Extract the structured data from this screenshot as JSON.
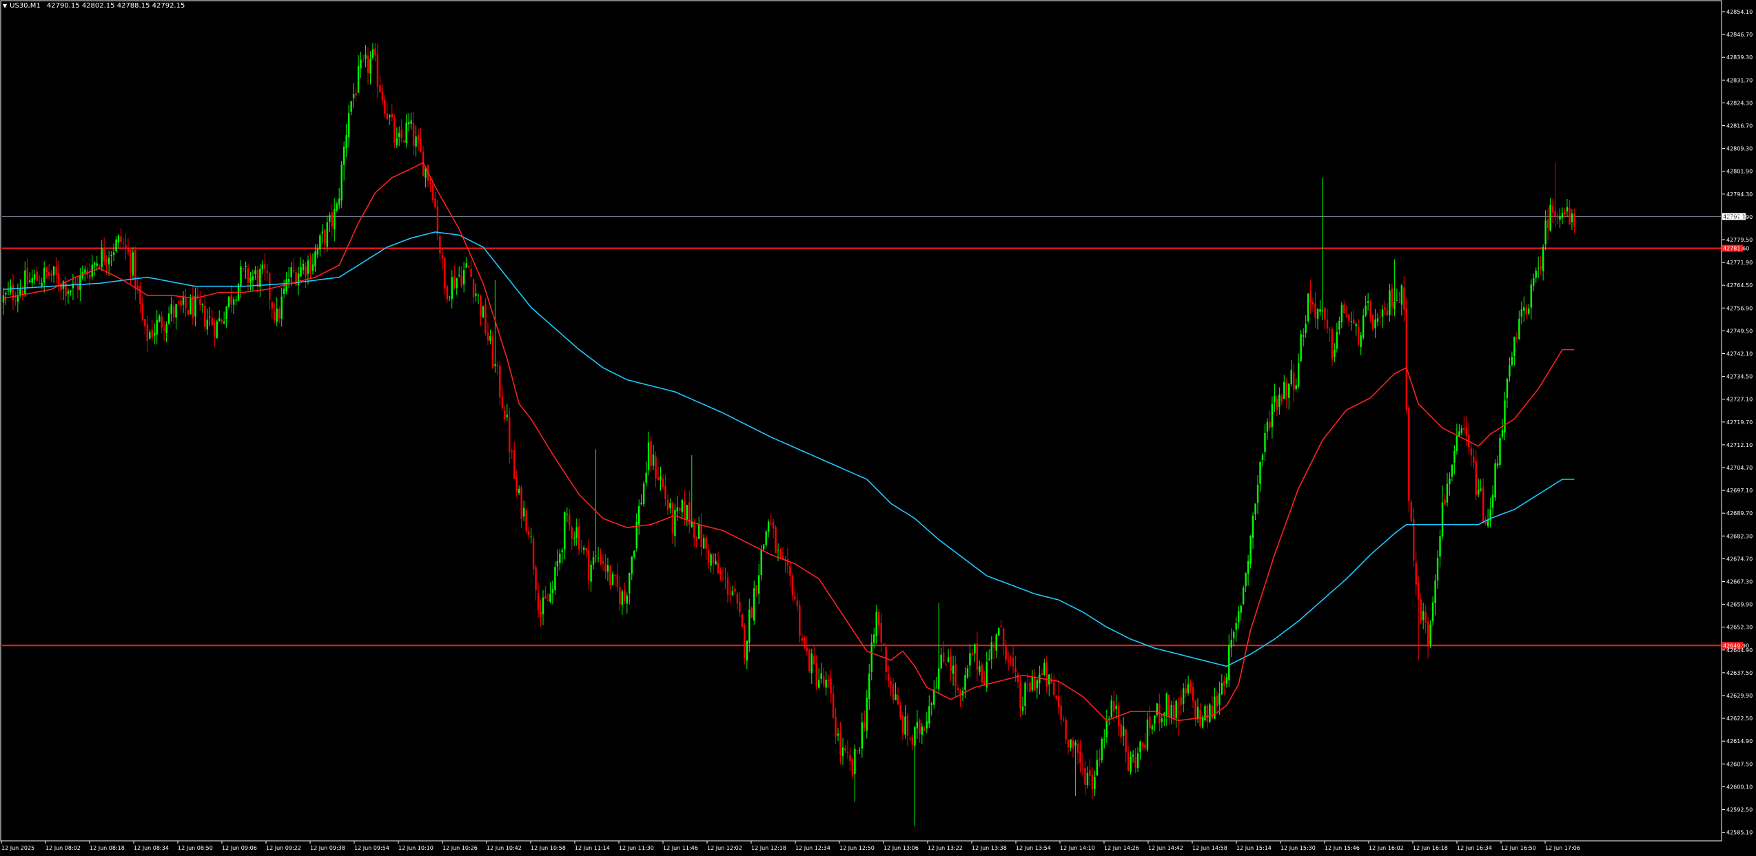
{
  "header": {
    "symbol": "US30,M1",
    "open": "42790.15",
    "high": "42802.15",
    "low": "42788.15",
    "close": "42792.15"
  },
  "colors": {
    "background": "#000000",
    "frame": "#ffffff",
    "bull": "#00ff00",
    "bear": "#ff0000",
    "ma_fast": "#ff2020",
    "ma_slow": "#1ec8ff",
    "hline": "#ff1a1a",
    "bid_line": "#7f8a99"
  },
  "chart_data": {
    "type": "candlestick",
    "ylim": [
      42585.1,
      42861.2
    ],
    "y_ticks": [
      "42854.10",
      "42846.70",
      "42839.30",
      "42831.70",
      "42824.30",
      "42816.70",
      "42809.30",
      "42801.90",
      "42794.30",
      "42786.90",
      "42779.50",
      "42771.90",
      "42764.50",
      "42756.90",
      "42749.50",
      "42742.10",
      "42734.50",
      "42727.10",
      "42719.70",
      "42712.10",
      "42704.70",
      "42697.10",
      "42689.70",
      "42682.30",
      "42674.70",
      "42667.30",
      "42659.90",
      "42652.30",
      "42644.90",
      "42637.50",
      "42629.90",
      "42622.50",
      "42614.90",
      "42607.50",
      "42600.10",
      "42592.50",
      "42585.10"
    ],
    "x_ticks": [
      "12 Jun 2025",
      "12 Jun 08:02",
      "12 Jun 08:18",
      "12 Jun 08:34",
      "12 Jun 08:50",
      "12 Jun 09:06",
      "12 Jun 09:22",
      "12 Jun 09:38",
      "12 Jun 09:54",
      "12 Jun 10:10",
      "12 Jun 10:26",
      "12 Jun 10:42",
      "12 Jun 10:58",
      "12 Jun 11:14",
      "12 Jun 11:30",
      "12 Jun 11:46",
      "12 Jun 12:02",
      "12 Jun 12:18",
      "12 Jun 12:34",
      "12 Jun 12:50",
      "12 Jun 13:06",
      "12 Jun 13:22",
      "12 Jun 13:38",
      "12 Jun 13:54",
      "12 Jun 14:10",
      "12 Jun 14:26",
      "12 Jun 14:42",
      "12 Jun 14:58",
      "12 Jun 15:14",
      "12 Jun 15:30",
      "12 Jun 15:46",
      "12 Jun 16:02",
      "12 Jun 16:18",
      "12 Jun 16:34",
      "12 Jun 16:50",
      "12 Jun 17:06"
    ],
    "horizontal_lines": [
      {
        "price": 42781.6,
        "label": "42781.60",
        "style": "solid"
      },
      {
        "price": 42649.9,
        "label": "42649.90",
        "style": "solid"
      }
    ],
    "bid_line": {
      "price": 42792.15,
      "label": "42792.15"
    },
    "anchors": [
      [
        0,
        42764
      ],
      [
        10,
        42770
      ],
      [
        20,
        42773
      ],
      [
        30,
        42768
      ],
      [
        40,
        42778
      ],
      [
        50,
        42784
      ],
      [
        55,
        42776
      ],
      [
        60,
        42752
      ],
      [
        70,
        42760
      ],
      [
        80,
        42762
      ],
      [
        90,
        42756
      ],
      [
        100,
        42772
      ],
      [
        110,
        42772
      ],
      [
        115,
        42758
      ],
      [
        120,
        42772
      ],
      [
        130,
        42778
      ],
      [
        140,
        42794
      ],
      [
        145,
        42828
      ],
      [
        150,
        42840
      ],
      [
        155,
        42844
      ],
      [
        160,
        42830
      ],
      [
        165,
        42815
      ],
      [
        170,
        42822
      ],
      [
        180,
        42802
      ],
      [
        185,
        42768
      ],
      [
        190,
        42772
      ],
      [
        195,
        42775
      ],
      [
        200,
        42762
      ],
      [
        205,
        42745
      ],
      [
        210,
        42728
      ],
      [
        215,
        42700
      ],
      [
        220,
        42690
      ],
      [
        225,
        42660
      ],
      [
        230,
        42668
      ],
      [
        235,
        42690
      ],
      [
        240,
        42688
      ],
      [
        245,
        42676
      ],
      [
        250,
        42680
      ],
      [
        255,
        42670
      ],
      [
        260,
        42665
      ],
      [
        265,
        42690
      ],
      [
        270,
        42713
      ],
      [
        275,
        42705
      ],
      [
        280,
        42690
      ],
      [
        285,
        42695
      ],
      [
        290,
        42688
      ],
      [
        295,
        42680
      ],
      [
        300,
        42672
      ],
      [
        305,
        42668
      ],
      [
        310,
        42650
      ],
      [
        315,
        42672
      ],
      [
        320,
        42692
      ],
      [
        325,
        42676
      ],
      [
        330,
        42670
      ],
      [
        335,
        42648
      ],
      [
        340,
        42640
      ],
      [
        345,
        42635
      ],
      [
        350,
        42615
      ],
      [
        355,
        42608
      ],
      [
        360,
        42626
      ],
      [
        365,
        42660
      ],
      [
        370,
        42640
      ],
      [
        375,
        42625
      ],
      [
        380,
        42618
      ],
      [
        385,
        42625
      ],
      [
        390,
        42640
      ],
      [
        395,
        42648
      ],
      [
        400,
        42630
      ],
      [
        405,
        42648
      ],
      [
        410,
        42640
      ],
      [
        415,
        42655
      ],
      [
        420,
        42648
      ],
      [
        425,
        42630
      ],
      [
        430,
        42638
      ],
      [
        435,
        42640
      ],
      [
        440,
        42632
      ],
      [
        445,
        42620
      ],
      [
        450,
        42610
      ],
      [
        455,
        42605
      ],
      [
        460,
        42622
      ],
      [
        465,
        42632
      ],
      [
        470,
        42610
      ],
      [
        475,
        42615
      ],
      [
        480,
        42625
      ],
      [
        485,
        42630
      ],
      [
        490,
        42628
      ],
      [
        495,
        42635
      ],
      [
        500,
        42625
      ],
      [
        505,
        42628
      ],
      [
        510,
        42640
      ],
      [
        515,
        42655
      ],
      [
        520,
        42680
      ],
      [
        525,
        42710
      ],
      [
        530,
        42730
      ],
      [
        535,
        42735
      ],
      [
        540,
        42740
      ],
      [
        545,
        42765
      ],
      [
        550,
        42760
      ],
      [
        555,
        42748
      ],
      [
        560,
        42762
      ],
      [
        565,
        42752
      ],
      [
        570,
        42760
      ],
      [
        575,
        42755
      ],
      [
        580,
        42766
      ],
      [
        585,
        42765
      ],
      [
        587,
        42700
      ],
      [
        590,
        42668
      ],
      [
        595,
        42652
      ],
      [
        600,
        42690
      ],
      [
        605,
        42712
      ],
      [
        610,
        42720
      ],
      [
        615,
        42704
      ],
      [
        620,
        42688
      ],
      [
        625,
        42720
      ],
      [
        630,
        42745
      ],
      [
        635,
        42762
      ],
      [
        640,
        42770
      ],
      [
        645,
        42792
      ],
      [
        650,
        42796
      ],
      [
        655,
        42789
      ]
    ],
    "spikes": [
      [
        140,
        42799
      ],
      [
        142,
        42804
      ],
      [
        151,
        42849
      ],
      [
        153,
        42847
      ],
      [
        205,
        42771
      ],
      [
        247,
        42715
      ],
      [
        287,
        42713
      ],
      [
        355,
        42598
      ],
      [
        380,
        42590
      ],
      [
        390,
        42664
      ],
      [
        440,
        42638
      ],
      [
        447,
        42600
      ],
      [
        490,
        42620
      ],
      [
        550,
        42805
      ],
      [
        600,
        42703
      ],
      [
        647,
        42810
      ],
      [
        580,
        42778
      ],
      [
        590,
        42645
      ]
    ],
    "ma_fast": [
      [
        0,
        42765
      ],
      [
        20,
        42768
      ],
      [
        30,
        42772
      ],
      [
        40,
        42775
      ],
      [
        50,
        42771
      ],
      [
        60,
        42766
      ],
      [
        70,
        42766
      ],
      [
        80,
        42765
      ],
      [
        90,
        42767
      ],
      [
        100,
        42767
      ],
      [
        110,
        42768
      ],
      [
        120,
        42770
      ],
      [
        130,
        42772
      ],
      [
        140,
        42776
      ],
      [
        148,
        42790
      ],
      [
        155,
        42800
      ],
      [
        162,
        42805
      ],
      [
        170,
        42808
      ],
      [
        175,
        42810
      ],
      [
        180,
        42802
      ],
      [
        190,
        42788
      ],
      [
        200,
        42770
      ],
      [
        210,
        42745
      ],
      [
        215,
        42730
      ],
      [
        220,
        42725
      ],
      [
        230,
        42712
      ],
      [
        240,
        42700
      ],
      [
        250,
        42692
      ],
      [
        260,
        42689
      ],
      [
        270,
        42690
      ],
      [
        280,
        42693
      ],
      [
        290,
        42690
      ],
      [
        300,
        42688
      ],
      [
        310,
        42684
      ],
      [
        320,
        42680
      ],
      [
        330,
        42677
      ],
      [
        340,
        42672
      ],
      [
        350,
        42660
      ],
      [
        360,
        42648
      ],
      [
        370,
        42645
      ],
      [
        375,
        42648
      ],
      [
        380,
        42643
      ],
      [
        385,
        42636
      ],
      [
        395,
        42632
      ],
      [
        405,
        42636
      ],
      [
        415,
        42638
      ],
      [
        425,
        42640
      ],
      [
        440,
        42638
      ],
      [
        450,
        42633
      ],
      [
        460,
        42625
      ],
      [
        470,
        42628
      ],
      [
        480,
        42628
      ],
      [
        490,
        42625
      ],
      [
        500,
        42626
      ],
      [
        505,
        42627
      ],
      [
        510,
        42630
      ],
      [
        515,
        42637
      ],
      [
        520,
        42655
      ],
      [
        530,
        42680
      ],
      [
        540,
        42702
      ],
      [
        550,
        42718
      ],
      [
        560,
        42728
      ],
      [
        570,
        42732
      ],
      [
        580,
        42740
      ],
      [
        585,
        42742
      ],
      [
        590,
        42730
      ],
      [
        600,
        42722
      ],
      [
        610,
        42718
      ],
      [
        615,
        42716
      ],
      [
        620,
        42720
      ],
      [
        630,
        42725
      ],
      [
        640,
        42735
      ],
      [
        650,
        42748
      ]
    ],
    "ma_slow": [
      [
        0,
        42768
      ],
      [
        40,
        42770
      ],
      [
        60,
        42772
      ],
      [
        80,
        42769
      ],
      [
        100,
        42769
      ],
      [
        120,
        42770
      ],
      [
        140,
        42772
      ],
      [
        150,
        42777
      ],
      [
        160,
        42782
      ],
      [
        170,
        42785
      ],
      [
        180,
        42787
      ],
      [
        190,
        42786
      ],
      [
        200,
        42782
      ],
      [
        210,
        42772
      ],
      [
        220,
        42762
      ],
      [
        230,
        42755
      ],
      [
        240,
        42748
      ],
      [
        250,
        42742
      ],
      [
        260,
        42738
      ],
      [
        280,
        42734
      ],
      [
        300,
        42727
      ],
      [
        320,
        42719
      ],
      [
        340,
        42712
      ],
      [
        360,
        42705
      ],
      [
        370,
        42697
      ],
      [
        380,
        42692
      ],
      [
        390,
        42685
      ],
      [
        400,
        42679
      ],
      [
        410,
        42673
      ],
      [
        420,
        42670
      ],
      [
        430,
        42667
      ],
      [
        440,
        42665
      ],
      [
        450,
        42661
      ],
      [
        460,
        42656
      ],
      [
        470,
        42652
      ],
      [
        480,
        42649
      ],
      [
        490,
        42647
      ],
      [
        500,
        42645
      ],
      [
        510,
        42643
      ],
      [
        520,
        42647
      ],
      [
        530,
        42652
      ],
      [
        540,
        42658
      ],
      [
        550,
        42665
      ],
      [
        560,
        42672
      ],
      [
        570,
        42680
      ],
      [
        580,
        42687
      ],
      [
        585,
        42690
      ],
      [
        595,
        42690
      ],
      [
        605,
        42690
      ],
      [
        615,
        42690
      ],
      [
        620,
        42692
      ],
      [
        630,
        42695
      ],
      [
        640,
        42700
      ],
      [
        650,
        42705
      ]
    ]
  }
}
